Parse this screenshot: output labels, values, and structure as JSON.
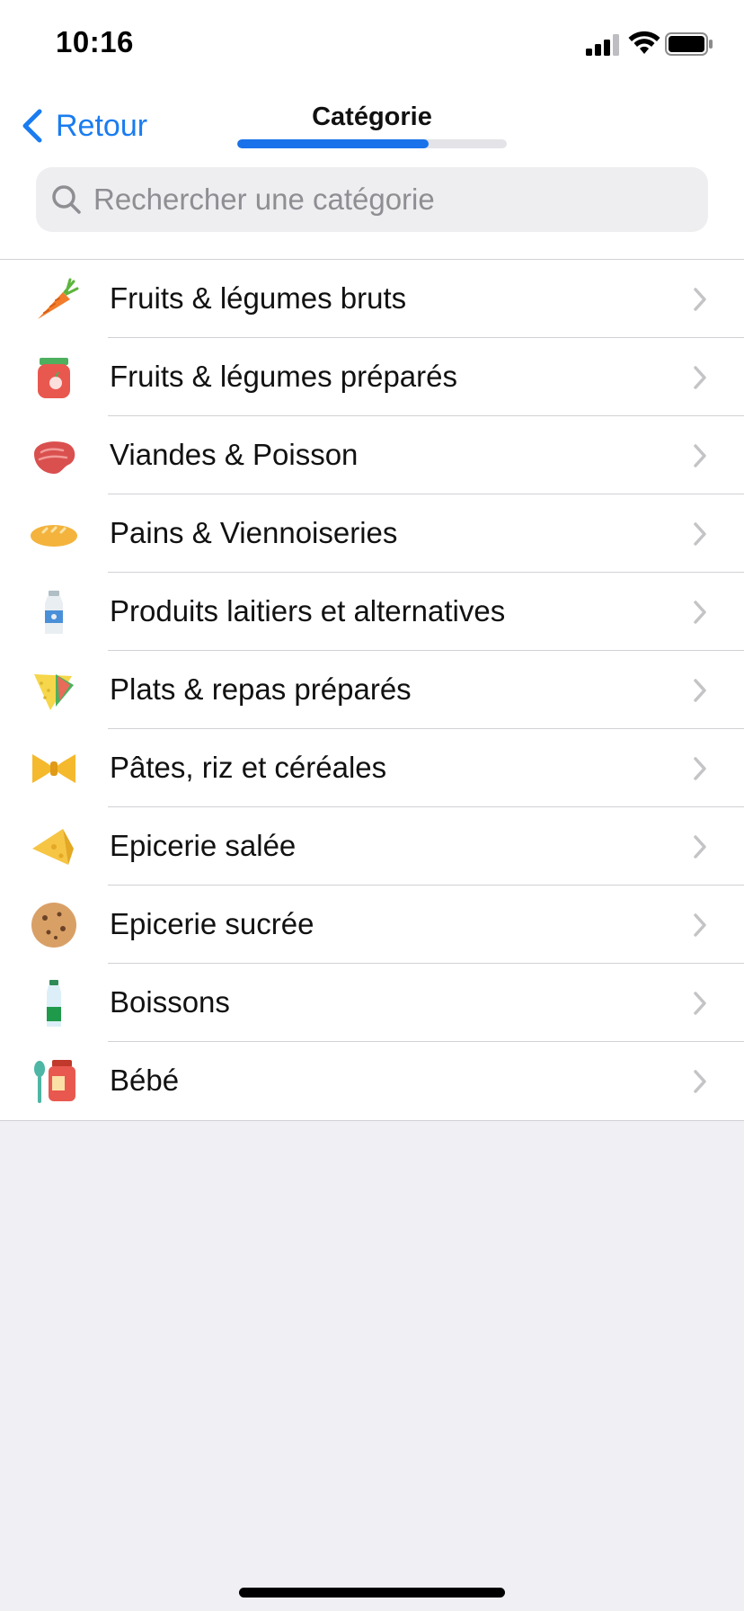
{
  "status_bar": {
    "time": "10:16"
  },
  "nav": {
    "back_label": "Retour",
    "title": "Catégorie",
    "progress": 0.71
  },
  "search": {
    "placeholder": "Rechercher une catégorie",
    "value": ""
  },
  "colors": {
    "accent": "#1A7CF0",
    "progress": "#1A72EA",
    "background": "#EFEFF4"
  },
  "categories": [
    {
      "label": "Fruits & légumes bruts",
      "icon": "carrot-icon"
    },
    {
      "label": "Fruits & légumes préparés",
      "icon": "jam-jar-icon"
    },
    {
      "label": "Viandes & Poisson",
      "icon": "steak-icon"
    },
    {
      "label": "Pains & Viennoiseries",
      "icon": "bread-icon"
    },
    {
      "label": "Produits laitiers et alternatives",
      "icon": "milk-bottle-icon"
    },
    {
      "label": "Plats & repas préparés",
      "icon": "sandwich-icon"
    },
    {
      "label": "Pâtes, riz et céréales",
      "icon": "pasta-bow-icon"
    },
    {
      "label": "Epicerie salée",
      "icon": "cheese-icon"
    },
    {
      "label": "Epicerie sucrée",
      "icon": "cookie-icon"
    },
    {
      "label": "Boissons",
      "icon": "water-bottle-icon"
    },
    {
      "label": "Bébé",
      "icon": "baby-food-icon"
    }
  ]
}
